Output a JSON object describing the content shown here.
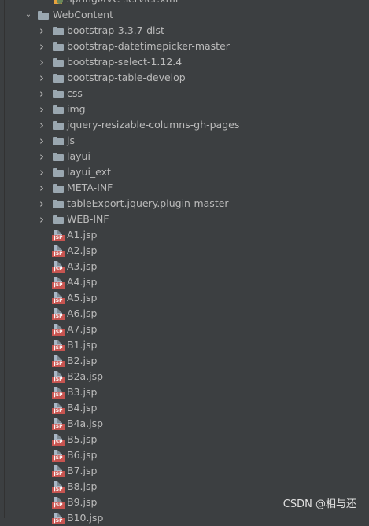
{
  "tree": {
    "top_file": "springMVC-servlet.xml",
    "root": {
      "label": "WebContent",
      "folders": [
        "bootstrap-3.3.7-dist",
        "bootstrap-datetimepicker-master",
        "bootstrap-select-1.12.4",
        "bootstrap-table-develop",
        "css",
        "img",
        "jquery-resizable-columns-gh-pages",
        "js",
        "layui",
        "layui_ext",
        "META-INF",
        "tableExport.jquery.plugin-master",
        "WEB-INF"
      ],
      "files": [
        "A1.jsp",
        "A2.jsp",
        "A3.jsp",
        "A4.jsp",
        "A5.jsp",
        "A6.jsp",
        "A7.jsp",
        "B1.jsp",
        "B2.jsp",
        "B2a.jsp",
        "B3.jsp",
        "B4.jsp",
        "B4a.jsp",
        "B5.jsp",
        "B6.jsp",
        "B7.jsp",
        "B8.jsp",
        "B9.jsp",
        "B10.jsp"
      ]
    }
  },
  "icons": {
    "collapsed_arrow": "chevron-right-icon",
    "expanded_arrow": "chevron-down-icon",
    "folder": "folder-icon",
    "jsp_file": "jsp-file-icon",
    "xml_file": "xml-file-icon",
    "jsp_tag": "JSP"
  },
  "colors": {
    "background": "#3c3f41",
    "text": "#bbbbbb",
    "folder": "#9aa7b0",
    "jsp_badge": "#c75450"
  },
  "watermark": "CSDN @相与还"
}
